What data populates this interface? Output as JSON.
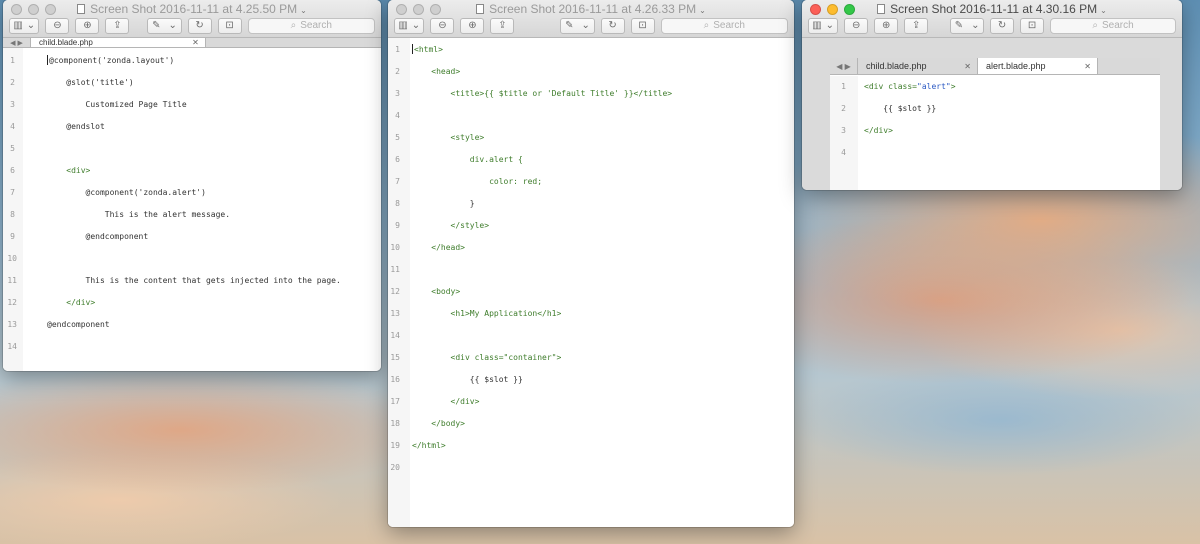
{
  "toolbar": {
    "search_placeholder": "Search"
  },
  "windows": [
    {
      "title": "Screen Shot 2016-11-11 at 4.25.50 PM",
      "tabs": [
        "child.blade.php"
      ],
      "lines": [
        {
          "n": "1",
          "code": "@component('zonda.layout')"
        },
        {
          "n": "2",
          "code": "    @slot('title')"
        },
        {
          "n": "3",
          "code": "        Customized Page Title"
        },
        {
          "n": "4",
          "code": "    @endslot"
        },
        {
          "n": "5",
          "code": ""
        },
        {
          "n": "6",
          "code": "    <div>"
        },
        {
          "n": "7",
          "code": "        @component('zonda.alert')"
        },
        {
          "n": "8",
          "code": "            This is the alert message."
        },
        {
          "n": "9",
          "code": "        @endcomponent"
        },
        {
          "n": "10",
          "code": ""
        },
        {
          "n": "11",
          "code": "        This is the content that gets injected into the page."
        },
        {
          "n": "12",
          "code": "    </div>"
        },
        {
          "n": "13",
          "code": "@endcomponent"
        },
        {
          "n": "14",
          "code": ""
        }
      ]
    },
    {
      "title": "Screen Shot 2016-11-11 at 4.26.33 PM",
      "lines": [
        {
          "n": "1",
          "code": "<html>"
        },
        {
          "n": "2",
          "code": "    <head>"
        },
        {
          "n": "3",
          "code": "        <title>{{ $title or 'Default Title' }}</title>"
        },
        {
          "n": "4",
          "code": ""
        },
        {
          "n": "5",
          "code": "        <style>"
        },
        {
          "n": "6",
          "code": "            div.alert {"
        },
        {
          "n": "7",
          "code": "                color: red;"
        },
        {
          "n": "8",
          "code": "            }"
        },
        {
          "n": "9",
          "code": "        </style>"
        },
        {
          "n": "10",
          "code": "    </head>"
        },
        {
          "n": "11",
          "code": ""
        },
        {
          "n": "12",
          "code": "    <body>"
        },
        {
          "n": "13",
          "code": "        <h1>My Application</h1>"
        },
        {
          "n": "14",
          "code": ""
        },
        {
          "n": "15",
          "code": "        <div class=\"container\">"
        },
        {
          "n": "16",
          "code": "            {{ $slot }}"
        },
        {
          "n": "17",
          "code": "        </div>"
        },
        {
          "n": "18",
          "code": "    </body>"
        },
        {
          "n": "19",
          "code": "</html>"
        },
        {
          "n": "20",
          "code": ""
        }
      ]
    },
    {
      "title": "Screen Shot 2016-11-11 at 4.30.16 PM",
      "tabs": [
        "child.blade.php",
        "alert.blade.php"
      ],
      "lines": [
        {
          "n": "1",
          "code": "<div class=\"alert\">"
        },
        {
          "n": "2",
          "code": "    {{ $slot }}"
        },
        {
          "n": "3",
          "code": "</div>"
        },
        {
          "n": "4",
          "code": ""
        }
      ]
    }
  ]
}
